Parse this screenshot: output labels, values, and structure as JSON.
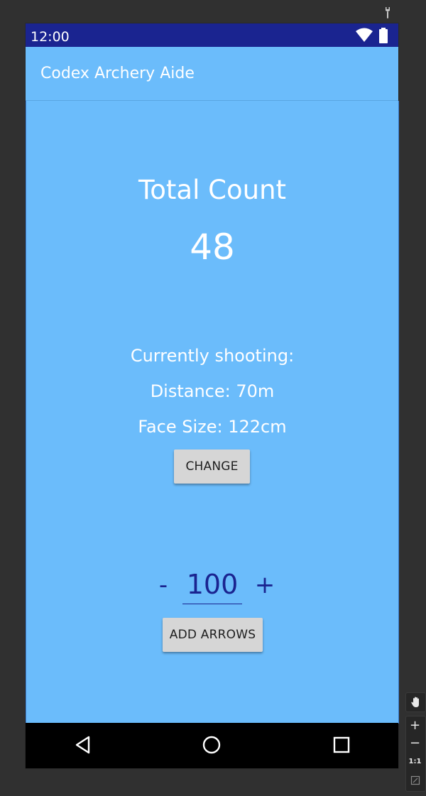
{
  "status_bar": {
    "time": "12:00",
    "icons": [
      "wifi-icon",
      "battery-icon"
    ]
  },
  "app_bar": {
    "title": "Codex Archery Aide"
  },
  "main": {
    "total_count_label": "Total Count",
    "total_count_value": "48",
    "shooting_label": "Currently shooting:",
    "distance": "Distance: 70m",
    "face_size": "Face Size: 122cm",
    "change_button": "CHANGE",
    "stepper": {
      "minus": "-",
      "value": "100",
      "plus": "+"
    },
    "add_arrows_button": "ADD ARROWS"
  },
  "nav_bar": {
    "buttons": [
      "back-icon",
      "home-icon",
      "recents-icon"
    ]
  },
  "emulator_toolbar": {
    "zoom_in": "+",
    "zoom_out": "−",
    "actual_size": "1:1"
  },
  "colors": {
    "status_bar": "#1a2490",
    "app_background": "#6bbcfb",
    "accent": "#1a2490",
    "button": "#d6d6d6",
    "text_on_primary": "#ffffff"
  }
}
